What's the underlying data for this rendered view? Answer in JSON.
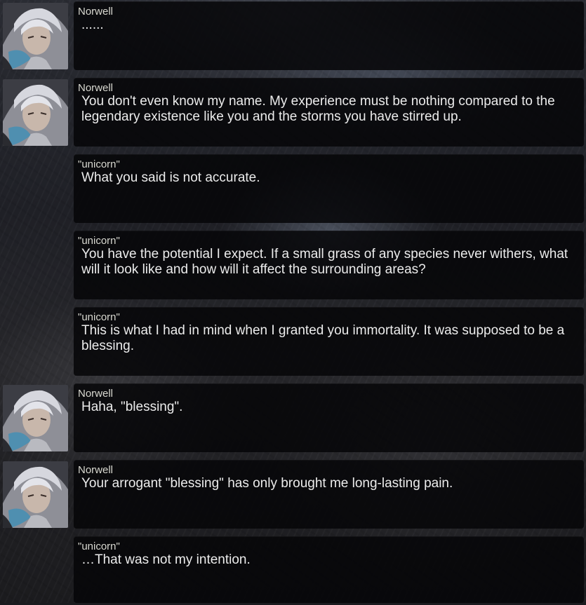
{
  "dialogue": [
    {
      "speaker": "Norwell",
      "has_avatar": true,
      "text": "......"
    },
    {
      "speaker": "Norwell",
      "has_avatar": true,
      "text": "You don't even know my name. My experience must be nothing compared to the legendary existence like you and the storms you have stirred up."
    },
    {
      "speaker": "\"unicorn\"",
      "has_avatar": false,
      "text": "What you said is not accurate."
    },
    {
      "speaker": "\"unicorn\"",
      "has_avatar": false,
      "text": "You have the potential I expect. If a small grass of any species never withers, what will it look like and how will it affect the surrounding areas?"
    },
    {
      "speaker": "\"unicorn\"",
      "has_avatar": false,
      "text": "This is what I had in mind when I granted you immortality. It was supposed to be a blessing."
    },
    {
      "speaker": "Norwell",
      "has_avatar": true,
      "text": "Haha, \"blessing\"."
    },
    {
      "speaker": "Norwell",
      "has_avatar": true,
      "text": "Your arrogant \"blessing\" has only brought me long-lasting pain."
    },
    {
      "speaker": "\"unicorn\"",
      "has_avatar": false,
      "text": "…That was not my intention."
    }
  ],
  "colors": {
    "box": "#060608",
    "speaker_text": "#d8d8d0",
    "dialogue_text": "#ececec"
  }
}
